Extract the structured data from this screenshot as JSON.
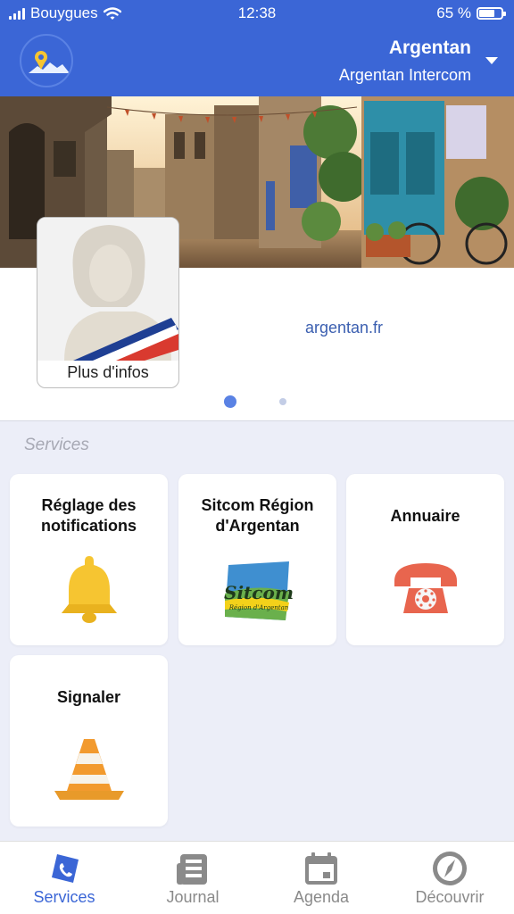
{
  "status_bar": {
    "carrier": "Bouygues",
    "time": "12:38",
    "battery": "65 %"
  },
  "header": {
    "town": "Argentan",
    "subtitle": "Argentan Intercom"
  },
  "info": {
    "card_label": "Plus d'infos",
    "website": "argentan.fr",
    "carousel_pages": 2,
    "carousel_active_page": 1
  },
  "services": {
    "section_title": "Services",
    "tiles": [
      {
        "label_line1": "Réglage des",
        "label_line2": "notifications",
        "icon": "bell-icon"
      },
      {
        "label_line1": "Sitcom Région",
        "label_line2": "d'Argentan",
        "icon": "sitcom-logo-icon",
        "logo_text": "Sitcom",
        "logo_subtext": "Région d'Argentan"
      },
      {
        "label_line1": "Annuaire",
        "label_line2": "",
        "icon": "telephone-icon"
      },
      {
        "label_line1": "Signaler",
        "label_line2": "",
        "icon": "traffic-cone-icon"
      }
    ]
  },
  "tabbar": {
    "tabs": [
      {
        "label": "Services",
        "icon": "services-icon",
        "active": true
      },
      {
        "label": "Journal",
        "icon": "journal-icon",
        "active": false
      },
      {
        "label": "Agenda",
        "icon": "calendar-icon",
        "active": false
      },
      {
        "label": "Découvrir",
        "icon": "compass-icon",
        "active": false
      }
    ]
  },
  "colors": {
    "brand_blue": "#3b66d6",
    "background": "#eceef8",
    "link": "#3b5fb0",
    "inactive_tab": "#8a8a8a"
  }
}
